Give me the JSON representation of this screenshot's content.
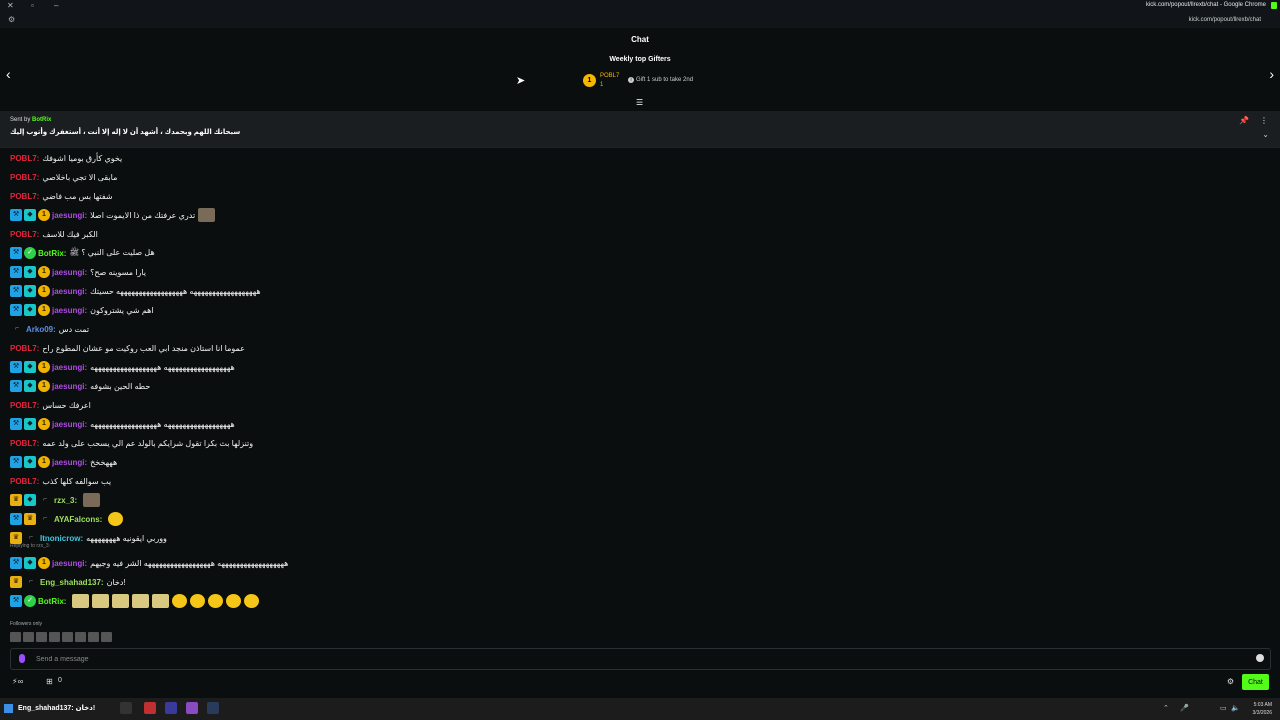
{
  "browser": {
    "window_title": "kick.com/popout/llrexb/chat - Google Chrome",
    "url": "kick.com/popout/llrexb/chat"
  },
  "header": {
    "title": "Chat"
  },
  "gifters": {
    "heading": "Weekly top Gifters",
    "top_rank": "1",
    "top_name": "POBL7",
    "top_count": "1",
    "gift_info": "Gift 1 sub to take 2nd"
  },
  "pinned": {
    "sent_by_label": "Sent by",
    "sender": "BotRix",
    "message": "سبحانك اللهم وبحمدك ، أشهد أن لا إله إلا أنت ، أستغفرك وأتوب إليك"
  },
  "messages": [
    {
      "user": "POBL7",
      "color": "#e0243c",
      "badges": [],
      "text": "يخوي كأرق بوميا اشوفك"
    },
    {
      "user": "POBL7",
      "color": "#e0243c",
      "badges": [],
      "text": "مابقى الا تجي باخلاصي"
    },
    {
      "user": "POBL7",
      "color": "#e0243c",
      "badges": [],
      "text": "شفتها بس مب فاضي"
    },
    {
      "user": "jaesungi",
      "color": "#b04ce6",
      "badges": [
        "blue",
        "cyan",
        "gold"
      ],
      "text": "تدري عرفتك من ذا الايموت اصلا",
      "emote": true
    },
    {
      "user": "POBL7",
      "color": "#e0243c",
      "badges": [],
      "text": "الكبر فيك للاسف"
    },
    {
      "user": "BotRix",
      "color": "#53fc18",
      "badges": [
        "blue",
        "green"
      ],
      "text": "هل صليت على النبي ؟ ﷺ"
    },
    {
      "user": "jaesungi",
      "color": "#b04ce6",
      "badges": [
        "blue",
        "cyan",
        "gold"
      ],
      "text": "يارا مسوينه صح؟"
    },
    {
      "user": "jaesungi",
      "color": "#b04ce6",
      "badges": [
        "blue",
        "cyan",
        "gold"
      ],
      "text": "ههههههههههههههههههه ههههههههههههههههههه حسيتك"
    },
    {
      "user": "jaesungi",
      "color": "#b04ce6",
      "badges": [
        "blue",
        "cyan",
        "gold"
      ],
      "text": "اهم شي يشتروكون"
    },
    {
      "user": "Arko09",
      "color": "#5b8fe6",
      "badges": [
        "gray"
      ],
      "text": "تمت دس"
    },
    {
      "user": "POBL7",
      "color": "#e0243c",
      "badges": [],
      "text": "عموما انا استاذن منجد ابي العب روكيت مو عشان المطوع راح"
    },
    {
      "user": "jaesungi",
      "color": "#b04ce6",
      "badges": [
        "blue",
        "cyan",
        "gold"
      ],
      "text": "ههههههههههههههههههه ههههههههههههههههههه"
    },
    {
      "user": "jaesungi",
      "color": "#b04ce6",
      "badges": [
        "blue",
        "cyan",
        "gold"
      ],
      "text": "حطه الحين بشوفه"
    },
    {
      "user": "POBL7",
      "color": "#e0243c",
      "badges": [],
      "text": "اعرفك حساس"
    },
    {
      "user": "jaesungi",
      "color": "#b04ce6",
      "badges": [
        "blue",
        "cyan",
        "gold"
      ],
      "text": "ههههههههههههههههههه ههههههههههههههههههه"
    },
    {
      "user": "POBL7",
      "color": "#e0243c",
      "badges": [],
      "text": "وتنزلها بث بكرا تقول شرايكم بالولد عم الي يسحب على ولد عمه"
    },
    {
      "user": "jaesungi",
      "color": "#b04ce6",
      "badges": [
        "blue",
        "cyan",
        "gold"
      ],
      "text": "هههخخخ"
    },
    {
      "user": "POBL7",
      "color": "#e0243c",
      "badges": [],
      "text": "يب سوالفه كلها كذب"
    },
    {
      "user": "rzx_3",
      "color": "#9ee05a",
      "badges": [
        "crown",
        "cyan",
        "gray"
      ],
      "text": "",
      "emote": true
    },
    {
      "user": "AYAFalcons",
      "color": "#9ee05a",
      "badges": [
        "blue",
        "crown",
        "gray"
      ],
      "text": "",
      "emote_yellow": true
    },
    {
      "user": "Itnonicrow",
      "color": "#40c8e0",
      "badges": [
        "crown",
        "gray"
      ],
      "text": "ووربي ايقونيه ههههههههه"
    },
    {
      "user": "jaesungi",
      "color": "#b04ce6",
      "badges": [
        "blue",
        "cyan",
        "gold"
      ],
      "text": "ههههههههههههههههههه ههههههههههههههههههه الشر فيه وجيهم",
      "reply": "Replying to rzx_3:"
    },
    {
      "user": "Eng_shahad137",
      "color": "#9ee05a",
      "badges": [
        "crown",
        "gray"
      ],
      "text": "دخان!"
    },
    {
      "user": "BotRix",
      "color": "#53fc18",
      "badges": [
        "blue",
        "green"
      ],
      "text": "",
      "emote_row": true
    }
  ],
  "reply_label": "Replying to rzx_3:",
  "followers_only": "Followers only",
  "input": {
    "placeholder": "Send a message"
  },
  "bottom": {
    "count": "0",
    "chat_button": "Chat"
  },
  "taskbar": {
    "preview": "Eng_shahad137: دخان!",
    "time": "5:03 AM",
    "date": "3/3/2026"
  }
}
